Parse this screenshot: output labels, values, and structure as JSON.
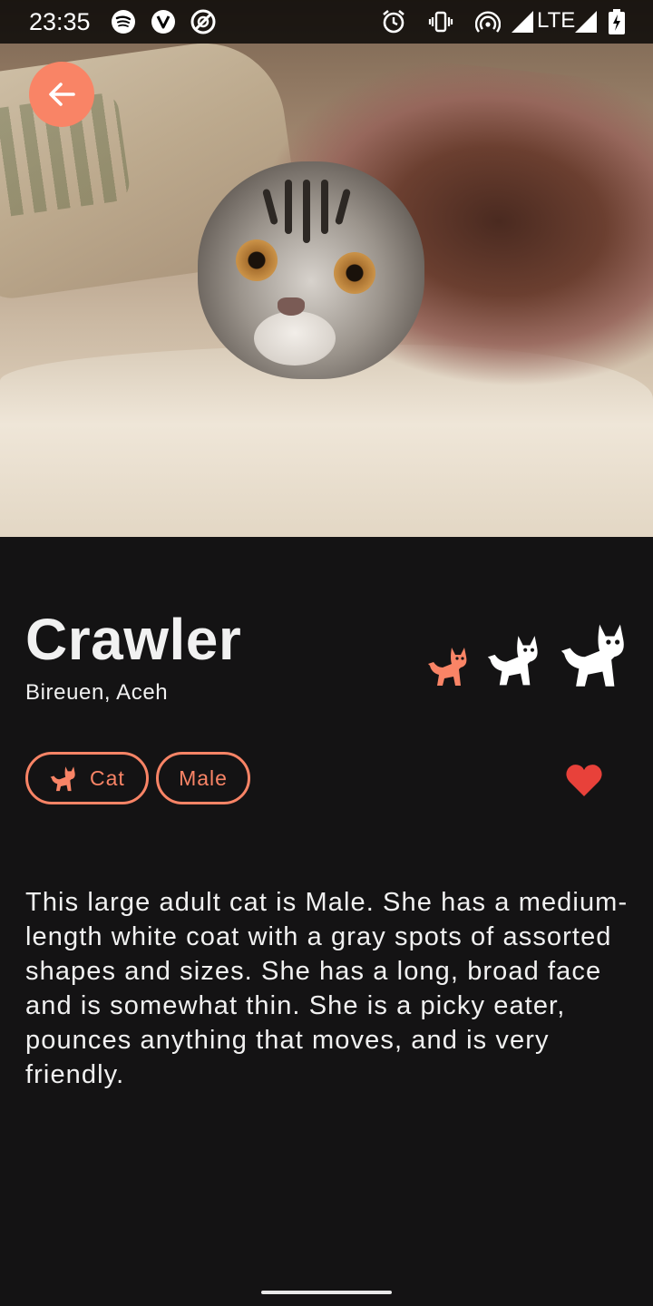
{
  "status_bar": {
    "time": "23:35",
    "left_icons": [
      "spotify-icon",
      "v-app-icon",
      "no-disturb-icon"
    ],
    "right_icons": [
      "alarm-icon",
      "vibrate-icon",
      "hotspot-icon",
      "signal-icon",
      "signal-icon",
      "battery-charging-icon"
    ],
    "network": "LTE"
  },
  "hero": {
    "image": "photo of a tabby kitten peeking out from under a blanket"
  },
  "pet": {
    "name": "Crawler",
    "location": "Bireuen, Aceh",
    "size_icons": [
      "cat-small-icon",
      "cat-medium-icon",
      "cat-large-icon"
    ],
    "size_selected": "small",
    "tags": [
      {
        "label": "Cat",
        "icon": "cat-icon"
      },
      {
        "label": "Male"
      }
    ],
    "favorite": true,
    "description": "This large adult cat is Male.  She has a medium-length white coat with a gray spots of assorted shapes and sizes.  She has a long, broad face and is somewhat thin.  She is a picky eater, pounces anything that moves, and is very friendly."
  },
  "colors": {
    "accent": "#f98466",
    "background": "#141314",
    "text": "#f1f1f1",
    "heart": "#e8413a"
  }
}
